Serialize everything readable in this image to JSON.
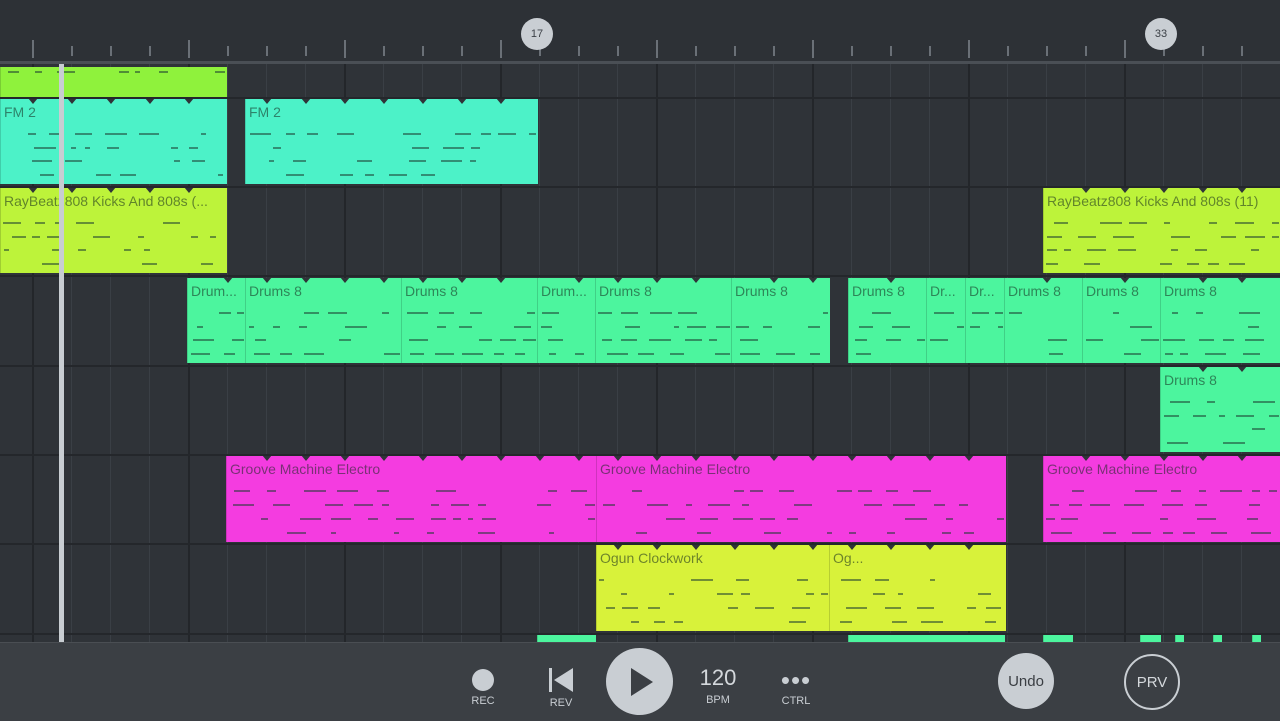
{
  "timeline": {
    "markers": [
      "17",
      "33"
    ]
  },
  "tracks": [
    {
      "clips": [
        {
          "name": "",
          "color": "#8ff23c"
        }
      ]
    },
    {
      "clips": [
        {
          "name": "FM 2",
          "color": "#4cf2c8"
        },
        {
          "name": "FM 2",
          "color": "#4cf2c8"
        }
      ]
    },
    {
      "clips": [
        {
          "name": "RayBeatz808 Kicks And 808s (...",
          "color": "#bdf33a"
        },
        {
          "name": "RayBeatz808 Kicks And 808s (11)",
          "color": "#bdf33a"
        }
      ]
    },
    {
      "clips": [
        {
          "name": "Drum...",
          "color": "#4cf59e"
        },
        {
          "name": "Drums 8",
          "color": "#4cf59e"
        },
        {
          "name": "Drums 8",
          "color": "#4cf59e"
        },
        {
          "name": "Drum...",
          "color": "#4cf59e"
        },
        {
          "name": "Drums 8",
          "color": "#4cf59e"
        },
        {
          "name": "Drums 8",
          "color": "#4cf59e"
        },
        {
          "name": "Drums 8",
          "color": "#4cf59e"
        },
        {
          "name": "Dr...",
          "color": "#4cf59e"
        },
        {
          "name": "Dr...",
          "color": "#4cf59e"
        },
        {
          "name": "Drums 8",
          "color": "#4cf59e"
        },
        {
          "name": "Drums 8",
          "color": "#4cf59e"
        },
        {
          "name": "Drums 8",
          "color": "#4cf59e"
        }
      ]
    },
    {
      "clips": [
        {
          "name": "Drums 8",
          "color": "#4cf59e"
        }
      ]
    },
    {
      "clips": [
        {
          "name": "Groove Machine Electro",
          "color": "#f43ce0"
        },
        {
          "name": "Groove Machine Electro",
          "color": "#f43ce0"
        },
        {
          "name": "Groove Machine Electro",
          "color": "#f43ce0"
        }
      ]
    },
    {
      "clips": [
        {
          "name": "Ogun Clockwork",
          "color": "#d8f23a"
        },
        {
          "name": "Og...",
          "color": "#d8f23a"
        }
      ]
    }
  ],
  "transport": {
    "rec_label": "REC",
    "rev_label": "REV",
    "bpm_value": "120",
    "bpm_label": "BPM",
    "ctrl_label": "CTRL",
    "undo_label": "Undo",
    "prv_label": "PRV"
  }
}
